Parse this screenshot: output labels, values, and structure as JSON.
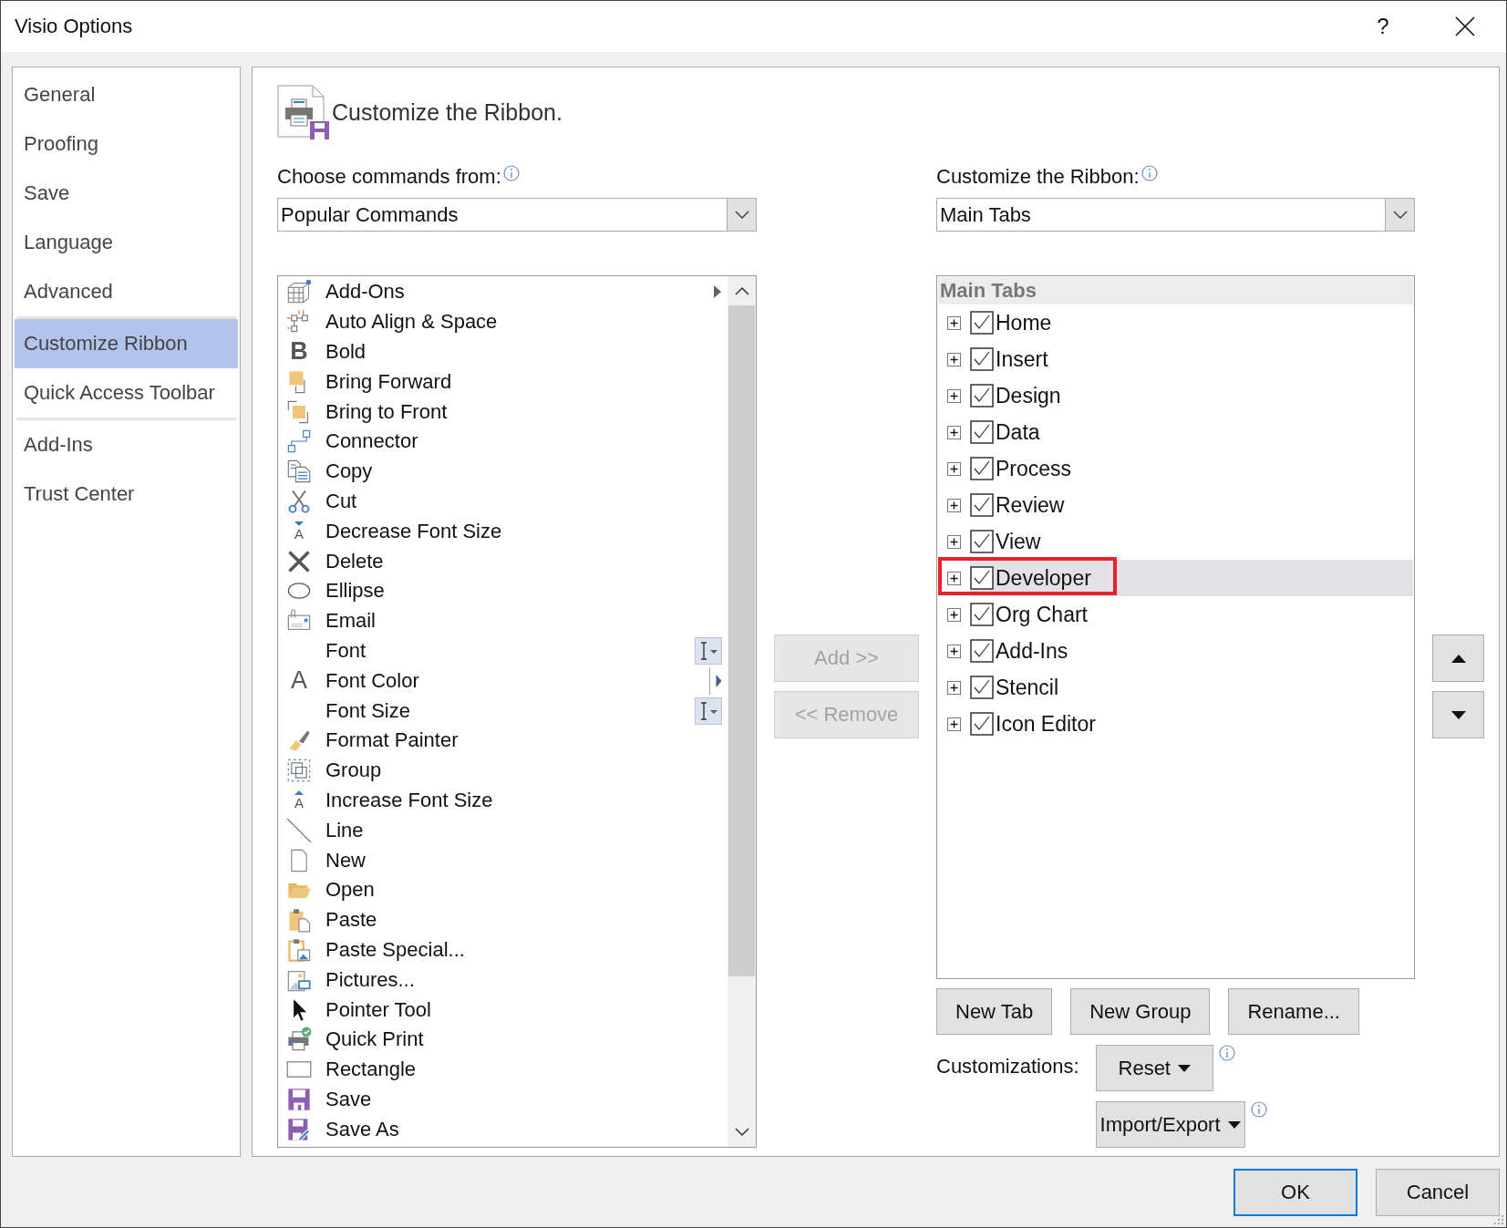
{
  "window": {
    "title": "Visio Options",
    "help": "?"
  },
  "sidebar": {
    "sections": [
      {
        "items": [
          {
            "label": "General",
            "selected": false
          },
          {
            "label": "Proofing",
            "selected": false
          },
          {
            "label": "Save",
            "selected": false
          },
          {
            "label": "Language",
            "selected": false
          },
          {
            "label": "Advanced",
            "selected": false
          }
        ]
      },
      {
        "items": [
          {
            "label": "Customize Ribbon",
            "selected": true
          },
          {
            "label": "Quick Access Toolbar",
            "selected": false
          }
        ]
      },
      {
        "items": [
          {
            "label": "Add-Ins",
            "selected": false
          },
          {
            "label": "Trust Center",
            "selected": false
          }
        ]
      }
    ]
  },
  "heading": "Customize the Ribbon.",
  "commands": {
    "label": "Choose commands from:",
    "dropdown": "Popular Commands",
    "items": [
      {
        "label": "Add-Ons",
        "kind": "submenu"
      },
      {
        "label": "Auto Align & Space",
        "kind": "command"
      },
      {
        "label": "Bold",
        "kind": "command",
        "glyph": "B"
      },
      {
        "label": "Bring Forward",
        "kind": "command"
      },
      {
        "label": "Bring to Front",
        "kind": "command"
      },
      {
        "label": "Connector",
        "kind": "command"
      },
      {
        "label": "Copy",
        "kind": "command"
      },
      {
        "label": "Cut",
        "kind": "command"
      },
      {
        "label": "Decrease Font Size",
        "kind": "command",
        "glyph": "A"
      },
      {
        "label": "Delete",
        "kind": "command"
      },
      {
        "label": "Ellipse",
        "kind": "command"
      },
      {
        "label": "Email",
        "kind": "command"
      },
      {
        "label": "Font",
        "kind": "combo"
      },
      {
        "label": "Font Color",
        "kind": "split",
        "glyph": "A"
      },
      {
        "label": "Font Size",
        "kind": "combo"
      },
      {
        "label": "Format Painter",
        "kind": "command"
      },
      {
        "label": "Group",
        "kind": "command"
      },
      {
        "label": "Increase Font Size",
        "kind": "command",
        "glyph": "A"
      },
      {
        "label": "Line",
        "kind": "command"
      },
      {
        "label": "New",
        "kind": "command"
      },
      {
        "label": "Open",
        "kind": "command"
      },
      {
        "label": "Paste",
        "kind": "command"
      },
      {
        "label": "Paste Special...",
        "kind": "command"
      },
      {
        "label": "Pictures...",
        "kind": "command"
      },
      {
        "label": "Pointer Tool",
        "kind": "command"
      },
      {
        "label": "Quick Print",
        "kind": "command"
      },
      {
        "label": "Rectangle",
        "kind": "command"
      },
      {
        "label": "Save",
        "kind": "command"
      },
      {
        "label": "Save As",
        "kind": "command"
      }
    ]
  },
  "transfer_buttons": [
    {
      "label": "Add >>",
      "disabled": true
    },
    {
      "label": "<< Remove",
      "disabled": true
    }
  ],
  "ribbon": {
    "label": "Customize the Ribbon:",
    "dropdown": "Main Tabs",
    "tree": {
      "header": "Main Tabs",
      "tabs": [
        {
          "label": "Home",
          "checked": true,
          "expanded": false,
          "selected": false,
          "annotated": false
        },
        {
          "label": "Insert",
          "checked": true,
          "expanded": false,
          "selected": false,
          "annotated": false
        },
        {
          "label": "Design",
          "checked": true,
          "expanded": false,
          "selected": false,
          "annotated": false
        },
        {
          "label": "Data",
          "checked": true,
          "expanded": false,
          "selected": false,
          "annotated": false
        },
        {
          "label": "Process",
          "checked": true,
          "expanded": false,
          "selected": false,
          "annotated": false
        },
        {
          "label": "Review",
          "checked": true,
          "expanded": false,
          "selected": false,
          "annotated": false
        },
        {
          "label": "View",
          "checked": true,
          "expanded": false,
          "selected": false,
          "annotated": false
        },
        {
          "label": "Developer",
          "checked": true,
          "expanded": false,
          "selected": true,
          "annotated": true
        },
        {
          "label": "Org Chart",
          "checked": true,
          "expanded": false,
          "selected": false,
          "annotated": false
        },
        {
          "label": "Add-Ins",
          "checked": true,
          "expanded": false,
          "selected": false,
          "annotated": false
        },
        {
          "label": "Stencil",
          "checked": true,
          "expanded": false,
          "selected": false,
          "annotated": false
        },
        {
          "label": "Icon Editor",
          "checked": true,
          "expanded": false,
          "selected": false,
          "annotated": false
        }
      ]
    },
    "buttons": [
      "New Tab",
      "New Group",
      "Rename..."
    ],
    "customizations_label": "Customizations:",
    "menu_buttons": [
      "Reset",
      "Import/Export"
    ]
  },
  "footer_buttons": [
    {
      "label": "OK",
      "default": true
    },
    {
      "label": "Cancel",
      "default": false
    }
  ]
}
